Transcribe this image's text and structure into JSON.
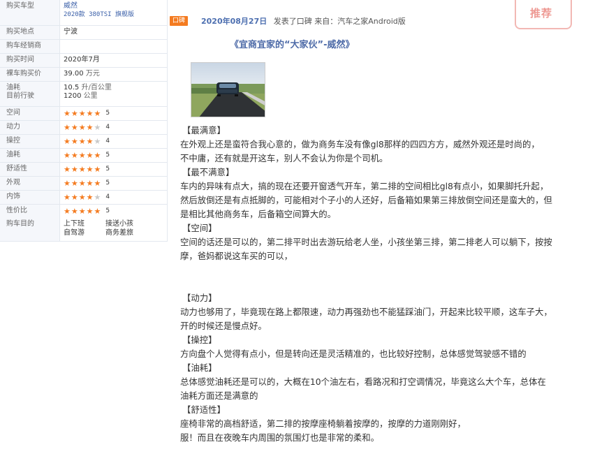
{
  "specs": {
    "model": {
      "label": "购买车型",
      "name": "威然",
      "detail": "2020款 380TSI 旗舰版"
    },
    "location": {
      "label": "购买地点",
      "value": "宁波"
    },
    "dealer": {
      "label": "购车经销商",
      "value": ""
    },
    "date": {
      "label": "购买时间",
      "value": "2020年7月"
    },
    "price": {
      "label": "裸车购买价",
      "value": "39.00",
      "unit": "万元"
    },
    "fuel": {
      "label1": "油耗",
      "label2": "目前行驶",
      "value1": "10.5",
      "unit1": "升/百公里",
      "value2": "1200",
      "unit2": "公里"
    },
    "ratings": [
      {
        "label": "空间",
        "score": 5
      },
      {
        "label": "动力",
        "score": 4
      },
      {
        "label": "操控",
        "score": 4
      },
      {
        "label": "油耗",
        "score": 5
      },
      {
        "label": "舒适性",
        "score": 5
      },
      {
        "label": "外观",
        "score": 5
      },
      {
        "label": "内饰",
        "score": 4
      },
      {
        "label": "性价比",
        "score": 5
      }
    ],
    "purpose": {
      "label": "购车目的",
      "items": [
        "上下班",
        "接送小孩",
        "自驾游",
        "商务差旅"
      ]
    }
  },
  "post": {
    "badge": "口碑",
    "date": "2020年08月27日",
    "action": "发表了口碑",
    "source": "来自：汽车之家Android版",
    "stamp": "推荐",
    "title": "《宜商宜家的“大家伙”-威然》"
  },
  "review": [
    "【最满意】",
    "在外观上还是蛮符合我心意的，做为商务车没有像gl8那样的四四方方，威然外观还是时尚的，",
    "不中庸，还有就是开这车，别人不会认为你是个司机。",
    "【最不满意】",
    "车内的异味有点大，搞的现在还要开窗透气开车，第二排的空间相比gl8有点小，如果脚托升起，",
    "然后放倒还是有点抵脚的，可能相对个子小的人还好，后备箱如果第三排放倒空间还是蛮大的，但",
    "是相比其他商务车，后备箱空间算大的。",
    "【空间】",
    "空间的话还是可以的，第二排平时出去游玩给老人坐，小孩坐第三排，第二排老人可以躺下，按按",
    "摩，爸妈都说这车买的可以，",
    "",
    "",
    "【动力】",
    "动力也够用了，毕竟现在路上都限速，动力再强劲也不能猛踩油门，开起来比较平顺，这车子大，",
    "开的时候还是慢点好。",
    "【操控】",
    "方向盘个人觉得有点小，但是转向还是灵活精准的，也比较好控制，总体感觉驾驶感不错的",
    "【油耗】",
    "总体感觉油耗还是可以的，大概在10个油左右，看路况和打空调情况，毕竟这么大个车，总体在",
    "油耗方面还是满意的",
    "【舒适性】",
    "座椅非常的高档舒适，第二排的按摩座椅躺着按摩的，按摩的力道刚刚好，",
    "服！而且在夜晚车内周围的氛围灯也是非常的柔和。"
  ],
  "colors": {
    "accent": "#f47b20",
    "link": "#3a5fa8",
    "title": "#4e6ba8",
    "stamp": "#ee9a94"
  }
}
